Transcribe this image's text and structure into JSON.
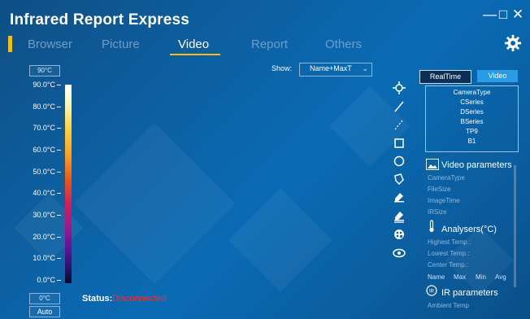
{
  "app": {
    "title": "Infrared Report Express",
    "window_controls": [
      "—",
      "□",
      "✕"
    ]
  },
  "nav": {
    "tabs": [
      {
        "label": "Browser"
      },
      {
        "label": "Picture"
      },
      {
        "label": "Video",
        "active": true
      },
      {
        "label": "Report"
      },
      {
        "label": "Others"
      }
    ],
    "settings_icon": "gear-icon"
  },
  "scale": {
    "max_box": "90°C",
    "min_box": "0°C",
    "auto_button": "Auto",
    "ticks": [
      "90.0°C",
      "80.0°C",
      "70.0°C",
      "60.0°C",
      "50.0°C",
      "40.0°C",
      "30.0°C",
      "20.0°C",
      "10.0°C",
      "0.0°C"
    ]
  },
  "status": {
    "label": "Status:",
    "value": "Disconnected",
    "value_color": "#ff2b2b"
  },
  "show": {
    "label": "Show:",
    "selected": "Name+MaxT"
  },
  "tools": [
    "crosshair-icon",
    "line-icon",
    "dashed-line-icon",
    "rectangle-icon",
    "circle-icon",
    "polygon-icon",
    "erase-icon",
    "erase-all-icon",
    "palette-icon",
    "eye-icon"
  ],
  "right_panel": {
    "realtime_label": "RealTime",
    "video_label": "Video",
    "camera_types": [
      "CameraType",
      "CSeries",
      "DSeries",
      "BSeries",
      "TP9",
      "B1"
    ],
    "video_parameters": {
      "title": "Video parameters",
      "fields": [
        "CameraType",
        "FileSize",
        "ImageTime",
        "IRSize"
      ]
    },
    "analysers": {
      "title": "Analysers(°C)",
      "fields": [
        "Highest Temp.:",
        "Lowest Temp.:",
        "Center Temp.:"
      ],
      "columns": [
        "Name",
        "Max",
        "Min",
        "Avg"
      ]
    },
    "ir_parameters": {
      "title": "IR parameters",
      "fields": [
        "Ambient Temp"
      ]
    }
  },
  "colors": {
    "accent": "#f2c012",
    "video_button": "#2c9be6",
    "inactive_tab": "#6f9cc6"
  }
}
